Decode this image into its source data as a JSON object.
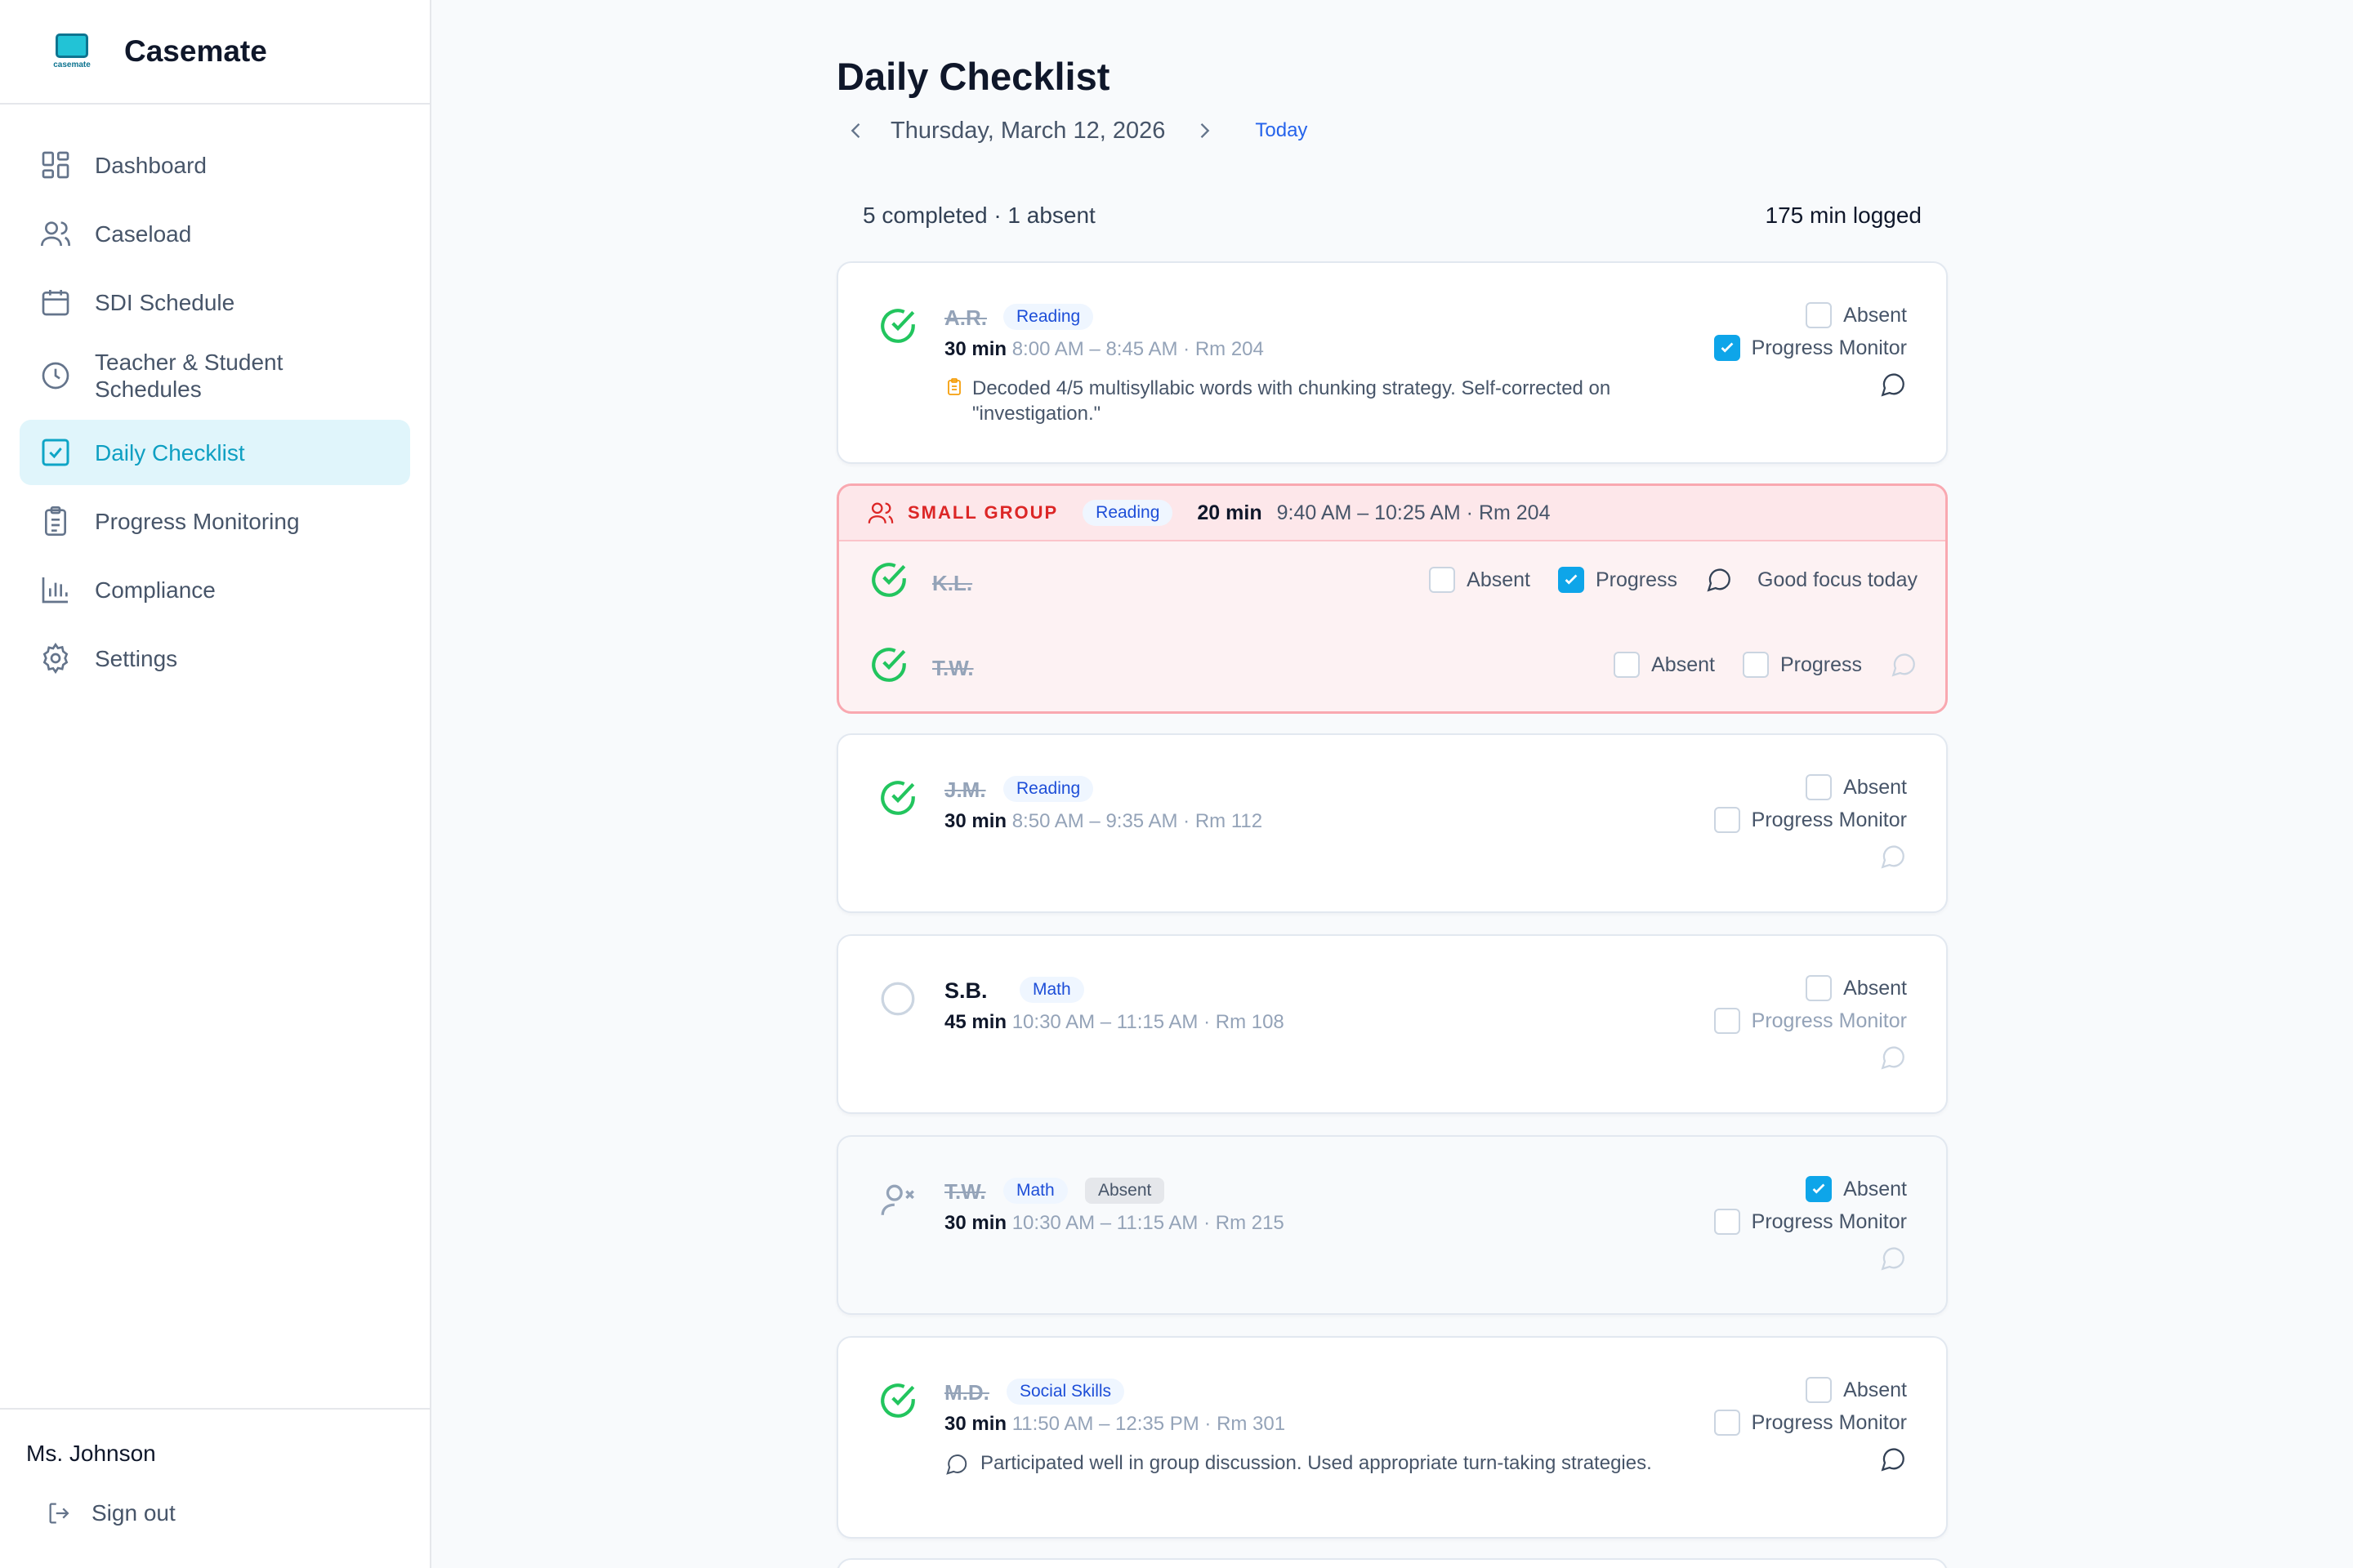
{
  "app": {
    "name": "Casemate",
    "logo_text": "casemate"
  },
  "sidebar": {
    "items": [
      {
        "label": "Dashboard",
        "icon": "dashboard-icon"
      },
      {
        "label": "Caseload",
        "icon": "users-icon"
      },
      {
        "label": "SDI Schedule",
        "icon": "calendar-icon"
      },
      {
        "label": "Teacher & Student Schedules",
        "icon": "clock-icon"
      },
      {
        "label": "Daily Checklist",
        "icon": "checkbox-icon",
        "active": true
      },
      {
        "label": "Progress Monitoring",
        "icon": "clipboard-icon"
      },
      {
        "label": "Compliance",
        "icon": "bar-chart-icon"
      },
      {
        "label": "Settings",
        "icon": "gear-icon"
      }
    ],
    "user": "Ms. Johnson",
    "signout": "Sign out"
  },
  "header": {
    "title": "Daily Checklist",
    "date": "Thursday, March 12, 2026",
    "today": "Today"
  },
  "summary": {
    "status": "5 completed · 1 absent",
    "logged": "175 min logged"
  },
  "labels": {
    "absent": "Absent",
    "progress_monitor": "Progress Monitor",
    "progress": "Progress",
    "small_group": "SMALL GROUP"
  },
  "sessions": [
    {
      "initials": "A.R.",
      "subject": "Reading",
      "minutes": "30 min",
      "time": "8:00 AM – 8:45 AM · Rm 204",
      "status": "done",
      "absent": false,
      "progress": true,
      "note": "Decoded 4/5 multisyllabic words with chunking strategy. Self-corrected on \"investigation.\""
    },
    {
      "initials": "J.M.",
      "subject": "Reading",
      "minutes": "30 min",
      "time": "8:50 AM – 9:35 AM · Rm 112",
      "status": "done",
      "absent": false,
      "progress": false
    },
    {
      "initials": "S.B.",
      "subject": "Math",
      "minutes": "45 min",
      "time": "10:30 AM – 11:15 AM · Rm 108",
      "status": "pending",
      "absent": false,
      "progress": false
    },
    {
      "initials": "T.W.",
      "subject": "Math",
      "badge": "Absent",
      "minutes": "30 min",
      "time": "10:30 AM – 11:15 AM · Rm 215",
      "status": "absent",
      "absent": true,
      "progress": false
    },
    {
      "initials": "M.D.",
      "subject": "Social Skills",
      "minutes": "30 min",
      "time": "11:50 AM – 12:35 PM · Rm 301",
      "status": "done",
      "absent": false,
      "progress": false,
      "note": "Participated well in group discussion. Used appropriate turn-taking strategies."
    }
  ],
  "group": {
    "subject": "Reading",
    "minutes": "20 min",
    "time": "9:40 AM – 10:25 AM · Rm 204",
    "students": [
      {
        "initials": "K.L.",
        "absent": false,
        "progress": true,
        "note": "Good focus today"
      },
      {
        "initials": "T.W.",
        "absent": false,
        "progress": false
      }
    ]
  },
  "colors": {
    "accent": "#0ea5c6",
    "done": "#22c55e",
    "group_border": "#f9a8b0",
    "group_label": "#dc2626"
  }
}
